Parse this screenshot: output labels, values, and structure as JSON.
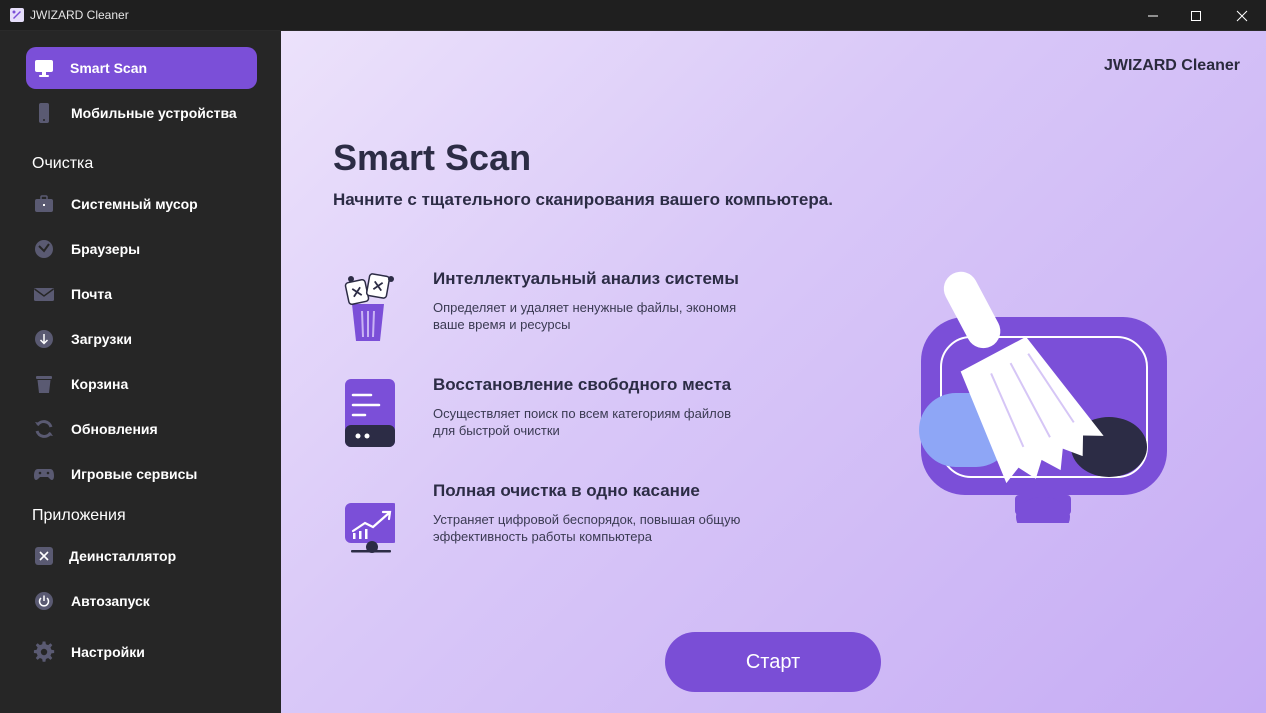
{
  "window": {
    "title": "JWIZARD Cleaner"
  },
  "sidebar": {
    "top_items": [
      {
        "label": "Smart Scan",
        "icon": "monitor-icon",
        "active": true
      },
      {
        "label": "Мобильные устройства",
        "icon": "phone-icon",
        "active": false
      }
    ],
    "sections": [
      {
        "title": "Очистка",
        "items": [
          {
            "label": "Системный мусор",
            "icon": "briefcase-icon"
          },
          {
            "label": "Браузеры",
            "icon": "browser-icon"
          },
          {
            "label": "Почта",
            "icon": "mail-icon"
          },
          {
            "label": "Загрузки",
            "icon": "download-icon"
          },
          {
            "label": "Корзина",
            "icon": "trash-icon"
          },
          {
            "label": "Обновления",
            "icon": "refresh-icon"
          },
          {
            "label": "Игровые сервисы",
            "icon": "gamepad-icon"
          }
        ]
      },
      {
        "title": "Приложения",
        "items": [
          {
            "label": "Деинсталлятор",
            "icon": "uninstall-icon"
          },
          {
            "label": "Автозапуск",
            "icon": "power-icon"
          }
        ]
      }
    ],
    "settings": {
      "label": "Настройки",
      "icon": "gear-icon"
    }
  },
  "main": {
    "brand": "JWIZARD Cleaner",
    "title": "Smart Scan",
    "subtitle": "Начните с тщательного сканирования вашего компьютера.",
    "features": [
      {
        "title": "Интеллектуальный анализ системы",
        "desc": "Определяет и удаляет ненужные файлы, экономя ваше время и ресурсы",
        "icon": "trash-bin-files-icon"
      },
      {
        "title": "Восстановление свободного места",
        "desc": "Осуществляет поиск по всем категориям файлов для быстрой очистки",
        "icon": "server-drive-icon"
      },
      {
        "title": "Полная очистка в одно касание",
        "desc": "Устраняет цифровой беспорядок, повышая общую эффективность работы компьютера",
        "icon": "performance-monitor-icon"
      }
    ],
    "start_button": "Старт"
  },
  "colors": {
    "accent": "#7b4fd8",
    "sidebar_bg": "#262626",
    "text_dark": "#2c2c45"
  }
}
